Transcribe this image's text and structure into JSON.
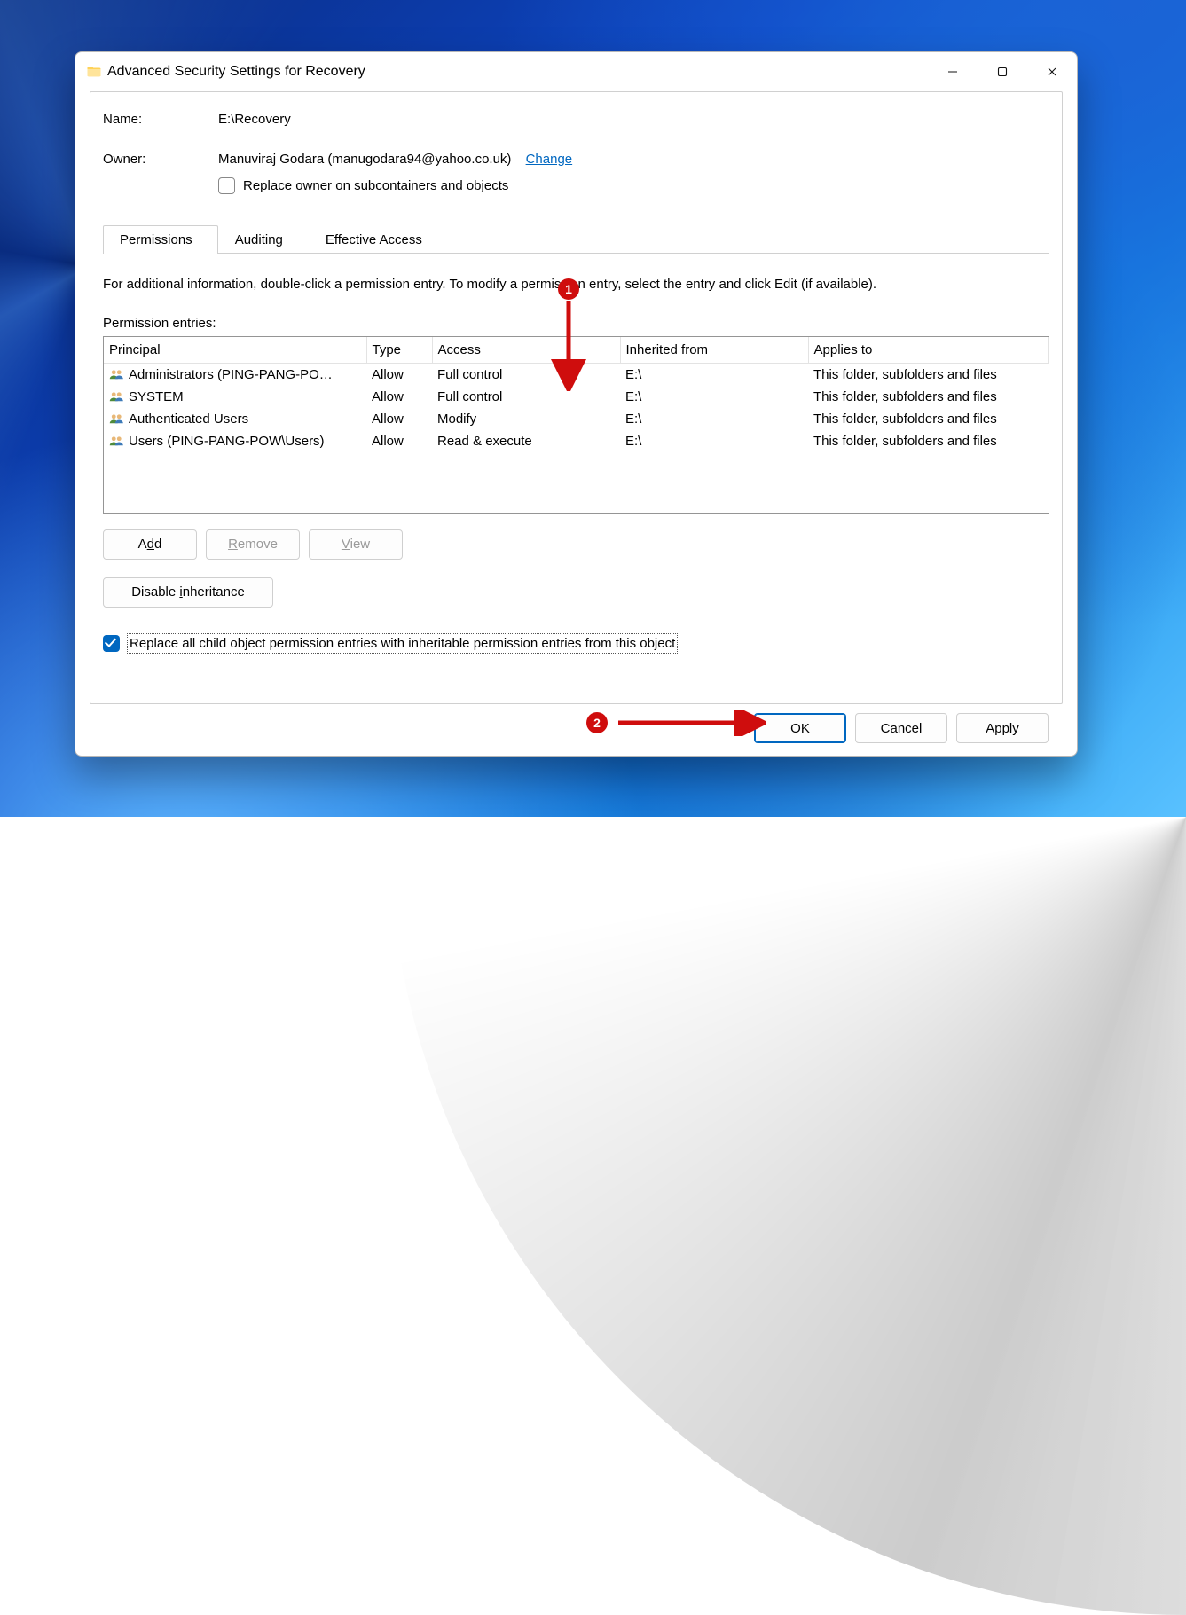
{
  "title": "Advanced Security Settings for Recovery",
  "nameLabel": "Name:",
  "nameValue": "E:\\Recovery",
  "ownerLabel": "Owner:",
  "ownerValue": "Manuviraj Godara (manugodara94@yahoo.co.uk)",
  "changeLink": "Change",
  "replaceOwner": {
    "label": "Replace owner on subcontainers and objects",
    "checked": false
  },
  "tabs": {
    "permissions": "Permissions",
    "auditing": "Auditing",
    "effective": "Effective Access",
    "active": 0
  },
  "permissions": {
    "info": "For additional information, double-click a permission entry. To modify a permission entry, select the entry and click Edit (if available).",
    "entriesLabel": "Permission entries:",
    "columns": {
      "principal": "Principal",
      "type": "Type",
      "access": "Access",
      "inherited": "Inherited from",
      "applies": "Applies to"
    },
    "rows": [
      {
        "principal": "Administrators (PING-PANG-PO…",
        "type": "Allow",
        "access": "Full control",
        "inherited": "E:\\",
        "applies": "This folder, subfolders and files"
      },
      {
        "principal": "SYSTEM",
        "type": "Allow",
        "access": "Full control",
        "inherited": "E:\\",
        "applies": "This folder, subfolders and files"
      },
      {
        "principal": "Authenticated Users",
        "type": "Allow",
        "access": "Modify",
        "inherited": "E:\\",
        "applies": "This folder, subfolders and files"
      },
      {
        "principal": "Users (PING-PANG-POW\\Users)",
        "type": "Allow",
        "access": "Read & execute",
        "inherited": "E:\\",
        "applies": "This folder, subfolders and files"
      }
    ],
    "buttons": {
      "add": {
        "pre": "A",
        "ul": "d",
        "post": "d"
      },
      "remove": {
        "pre": "",
        "ul": "R",
        "post": "emove"
      },
      "view": {
        "pre": "",
        "ul": "V",
        "post": "iew"
      }
    },
    "disableInheritance": {
      "pre": "Disable ",
      "ul": "i",
      "post": "nheritance"
    },
    "replaceChild": {
      "label": "Replace all child object permission entries with inheritable permission entries from this object",
      "checked": true
    }
  },
  "footer": {
    "ok": "OK",
    "cancel": "Cancel",
    "apply": "Apply"
  },
  "annotations": {
    "one": "1",
    "two": "2"
  }
}
